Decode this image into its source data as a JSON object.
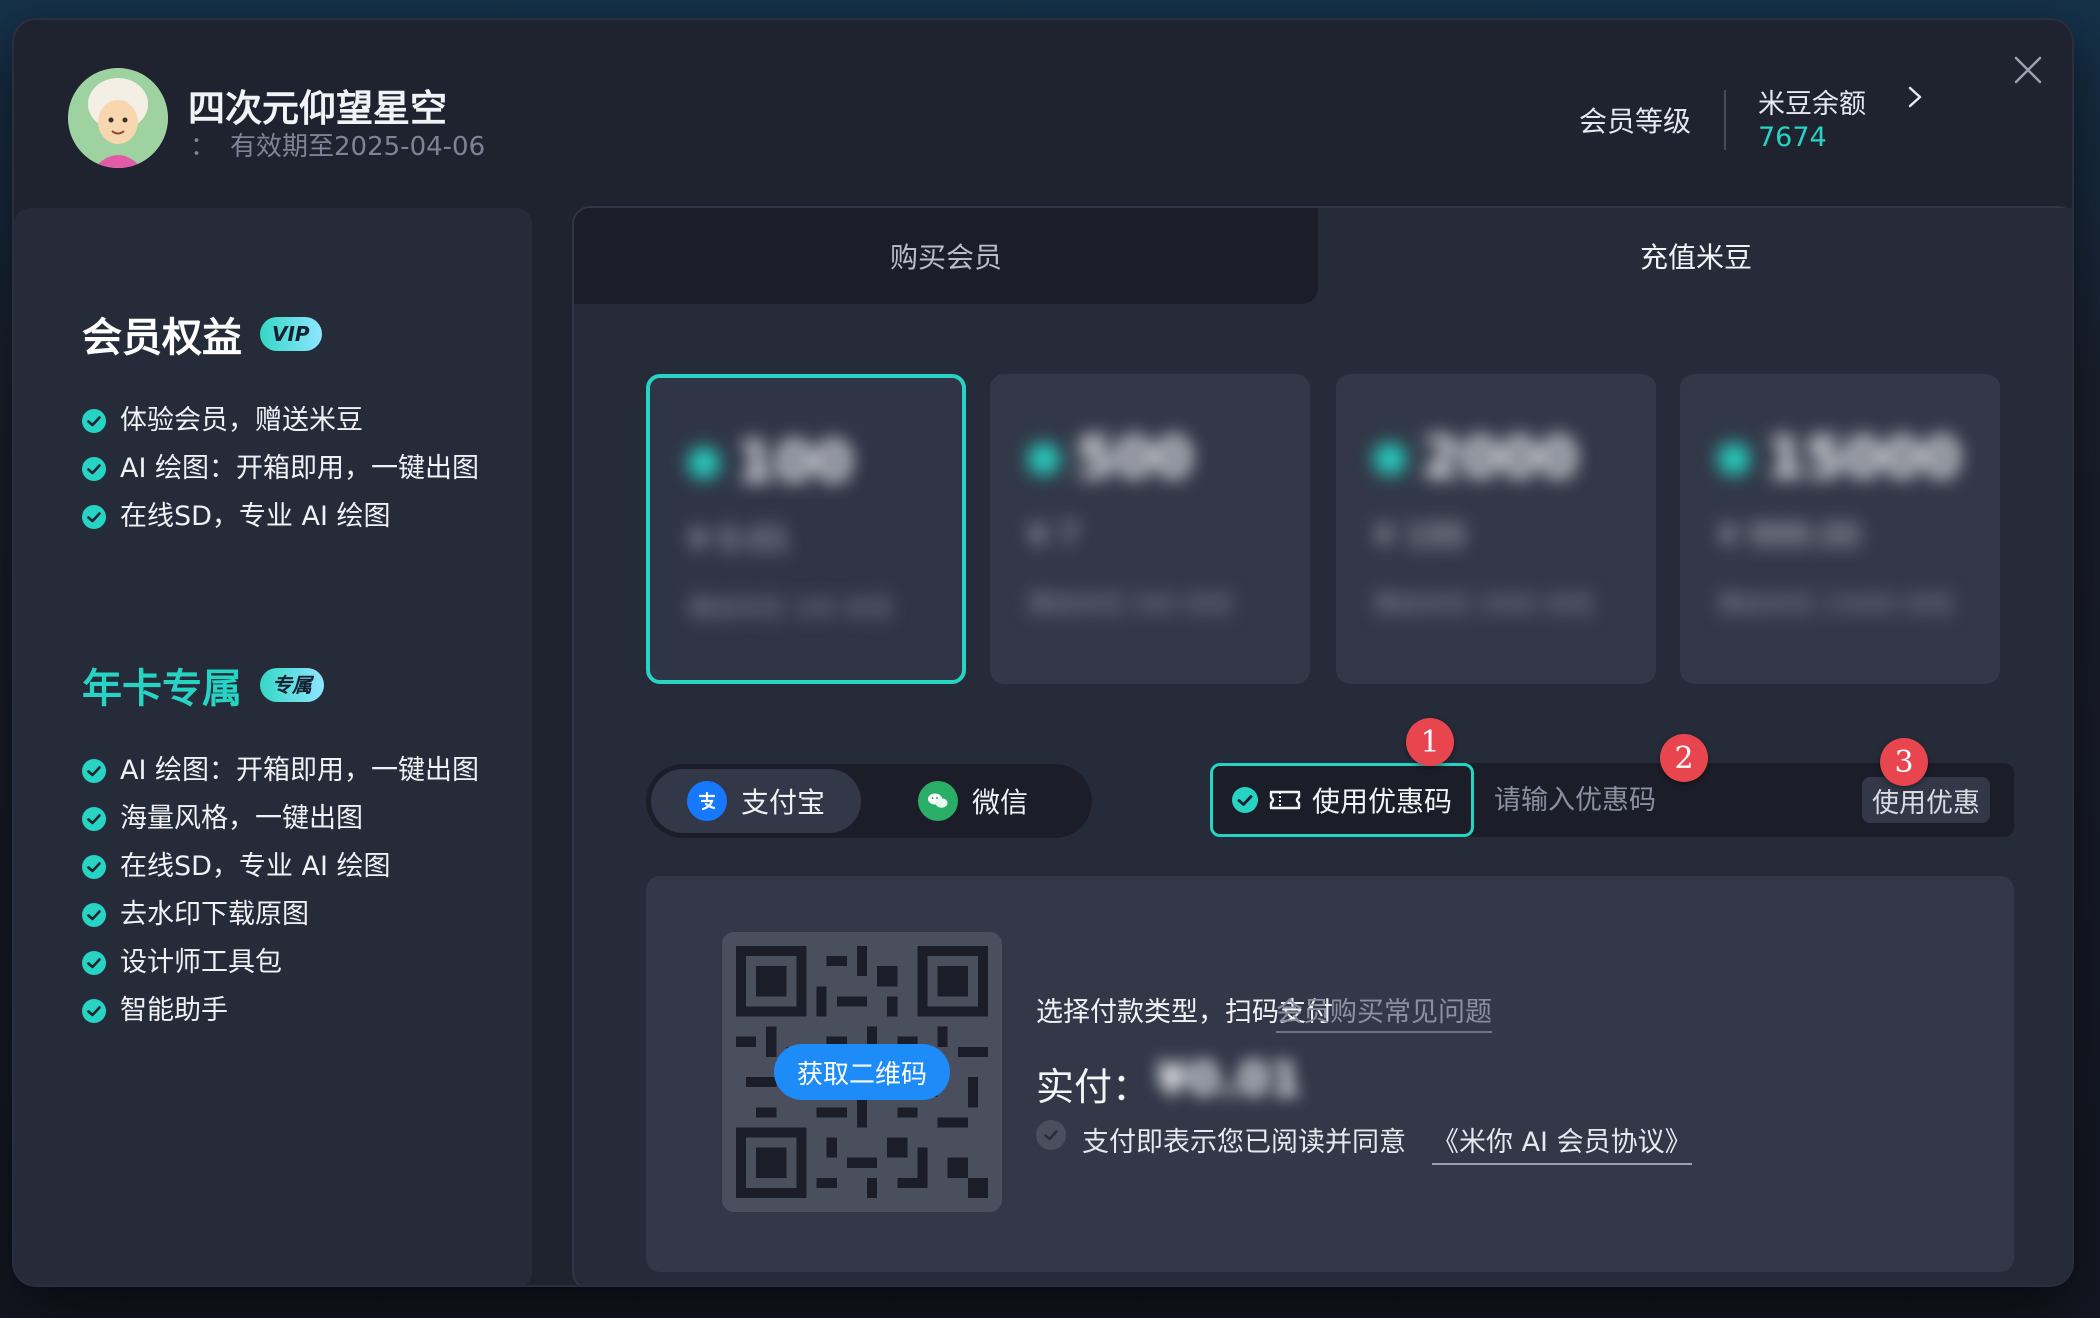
{
  "header": {
    "username": "四次元仰望星空",
    "expiry_prefix": "：",
    "expiry": "有效期至2025-04-06",
    "level_label": "会员等级",
    "balance_label": "米豆余额",
    "balance_value": "7674"
  },
  "benefits": {
    "vip_title": "会员权益",
    "vip_badge": "VIP",
    "vip_items": [
      "体验会员，赠送米豆",
      "AI 绘图：开箱即用，一键出图",
      "在线SD，专业 AI 绘图"
    ],
    "year_title": "年卡专属",
    "year_badge": "专属",
    "year_items": [
      "AI 绘图：开箱即用，一键出图",
      "海量风格，一键出图",
      "在线SD，专业 AI 绘图",
      "去水印下载原图",
      "设计师工具包",
      "智能助手"
    ]
  },
  "tabs": {
    "buy": "购买会员",
    "recharge": "充值米豆"
  },
  "bean_cards": [
    {
      "amount": "100",
      "price": "¥ 0.01",
      "desc": "赠送米豆 100 米豆"
    },
    {
      "amount": "500",
      "price": "¥ 7",
      "desc": "赠送米豆 500 米豆"
    },
    {
      "amount": "2000",
      "price": "¥ 100",
      "desc": "赠送米豆 2000 米豆"
    },
    {
      "amount": "15000",
      "price": "¥ 999.00",
      "desc": "赠送米豆 15000 米豆"
    }
  ],
  "payment": {
    "alipay": "支付宝",
    "wechat": "微信"
  },
  "coupon": {
    "toggle_label": "使用优惠码",
    "placeholder": "请输入优惠码",
    "apply_label": "使用优惠"
  },
  "markers": [
    "1",
    "2",
    "3"
  ],
  "qr": {
    "get_button": "获取二维码",
    "instruction": "选择付款类型，扫码支付",
    "faq_link": "会员购买常见问题",
    "actual_label": "实付：",
    "actual_value": "¥0.01",
    "agree_text": "支付即表示您已阅读并同意",
    "agreement_link": "《米你 AI 会员协议》"
  },
  "colors": {
    "accent": "#27d3c3",
    "marker": "#e9454f",
    "qr_button": "#1d8cf8"
  }
}
